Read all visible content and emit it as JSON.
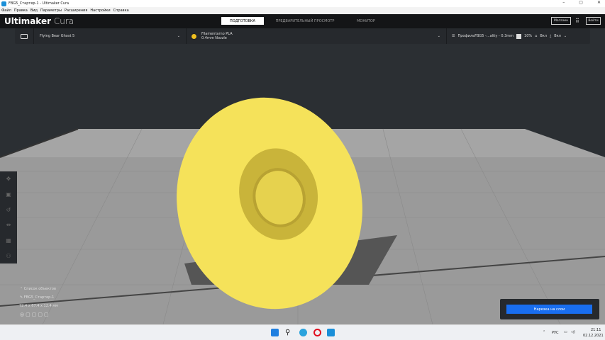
{
  "window": {
    "title": "FBG5_Стартер-1 - Ultimaker Cura",
    "minimize": "–",
    "maximize": "▢",
    "close": "✕"
  },
  "menu": [
    "Файл",
    "Правка",
    "Вид",
    "Параметры",
    "Расширения",
    "Настройки",
    "Справка"
  ],
  "header": {
    "brand_main": "Ultimaker",
    "brand_sub": "Cura",
    "tabs": [
      "ПОДГОТОВКА",
      "ПРЕДВАРИТЕЛЬНЫЙ ПРОСМОТР",
      "МОНИТОР"
    ],
    "marketplace": "Магазин",
    "signin": "Войти"
  },
  "toolbar": {
    "printer": "Flying Bear Ghost 5",
    "material": "Filamentarno PLA",
    "nozzle": "0.4mm Nozzle",
    "profile": "ПрофильFBG5 -...ality - 0.3mm",
    "infill": "10%",
    "support": "Вкл",
    "adhesion": "Вкл"
  },
  "objects": {
    "header": "Список объектов",
    "name": "FBG5_Стартер-1",
    "dims": "72.4 x 67.4 x 12.4 мм"
  },
  "slice_button": "Нарезка на слои",
  "tray": {
    "lang": "РУС",
    "time": "21:11",
    "date": "02.12.2021"
  },
  "colors": {
    "accent": "#196ef0",
    "model": "#f5e25a"
  }
}
